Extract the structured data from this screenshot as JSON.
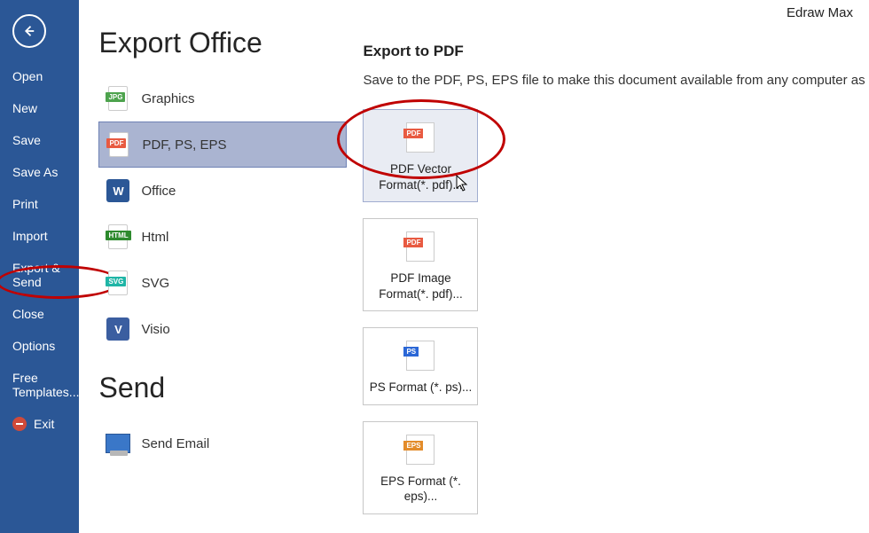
{
  "app": {
    "title": "Edraw Max"
  },
  "sidebar": {
    "items": [
      {
        "label": "Open"
      },
      {
        "label": "New"
      },
      {
        "label": "Save"
      },
      {
        "label": "Save As"
      },
      {
        "label": "Print"
      },
      {
        "label": "Import"
      },
      {
        "label": "Export & Send"
      },
      {
        "label": "Close"
      },
      {
        "label": "Options"
      },
      {
        "label": "Free Templates..."
      },
      {
        "label": "Exit"
      }
    ]
  },
  "export": {
    "heading": "Export Office",
    "items": {
      "graphics": "Graphics",
      "pdf": "PDF, PS, EPS",
      "office": "Office",
      "html": "Html",
      "svg": "SVG",
      "visio": "Visio"
    }
  },
  "send": {
    "heading": "Send",
    "email": "Send Email"
  },
  "right": {
    "heading": "Export to PDF",
    "desc": "Save to the PDF, PS, EPS file to make this document available from any computer as PDF",
    "tiles": {
      "pdf_vector": "PDF Vector Format(*. pdf)...",
      "pdf_image": "PDF Image Format(*. pdf)...",
      "ps": "PS Format (*. ps)...",
      "eps": "EPS Format (*. eps)..."
    }
  },
  "icons": {
    "jpg": "JPG",
    "pdf": "PDF",
    "html": "HTML",
    "svg": "SVG",
    "ps": "PS",
    "eps": "EPS",
    "word": "W",
    "visio": "V"
  }
}
